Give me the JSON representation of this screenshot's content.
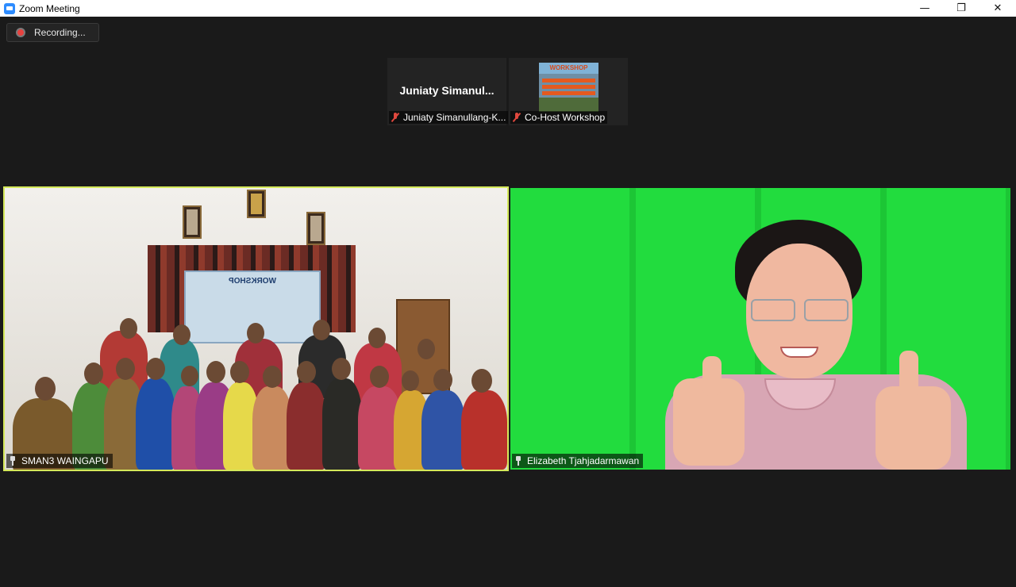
{
  "window": {
    "title": "Zoom Meeting",
    "controls": {
      "minimize": "—",
      "restore": "❐",
      "close": "✕"
    }
  },
  "recording": {
    "label": "Recording..."
  },
  "thumbnails": [
    {
      "display_name": "Juniaty  Simanul...",
      "caption": "Juniaty Simanullang-K...",
      "muted": true
    },
    {
      "caption": "Co-Host Workshop",
      "muted": true,
      "poster_title": "WORKSHOP"
    }
  ],
  "main_tiles": [
    {
      "caption": "SMAN3 WAINGAPU",
      "active_speaker": true,
      "banner_text": "WORKSHOP"
    },
    {
      "caption": "Elizabeth Tjahjadarmawan",
      "active_speaker": false
    }
  ],
  "colors": {
    "active_speaker_border": "#d4e85a",
    "muted_icon": "#e0483e",
    "recording_dot": "#e8423f",
    "background": "#1a1a1a"
  }
}
